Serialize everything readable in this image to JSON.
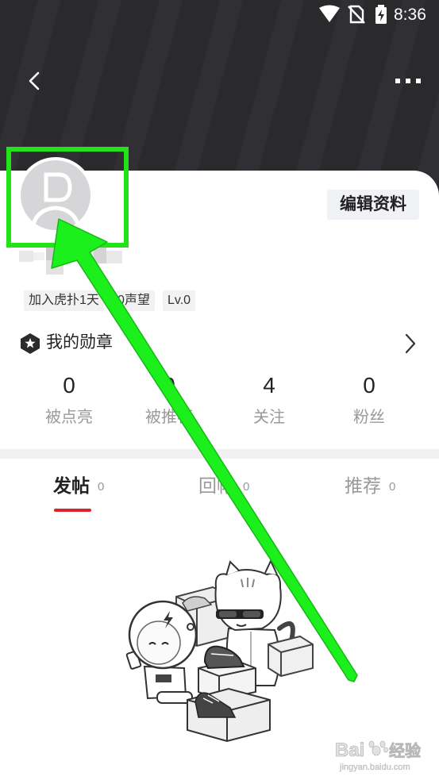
{
  "status_bar": {
    "time": "8:36",
    "icons": [
      "wifi-icon",
      "no-sim-icon",
      "battery-charging-icon"
    ]
  },
  "header": {
    "back_icon": "chevron-left-icon",
    "more_icon": "more-dots-icon"
  },
  "profile": {
    "avatar_icon": "default-avatar-icon",
    "edit_button_label": "编辑资料",
    "tags": [
      "加入虎扑1天",
      "0声望",
      "Lv.0"
    ]
  },
  "medals": {
    "label": "我的勋章",
    "icon": "medal-hexagon-star-icon"
  },
  "stats": [
    {
      "value": "0",
      "label": "被点亮"
    },
    {
      "value": "0",
      "label": "被推荐"
    },
    {
      "value": "4",
      "label": "关注"
    },
    {
      "value": "0",
      "label": "粉丝"
    }
  ],
  "tabs": [
    {
      "label": "发帖",
      "count": "0",
      "active": true
    },
    {
      "label": "回帖",
      "count": "0",
      "active": false
    },
    {
      "label": "推荐",
      "count": "0",
      "active": false
    }
  ],
  "watermark": {
    "brand_left": "Bai",
    "brand_right": "经验",
    "url": "jingyan.baidu.com"
  },
  "colors": {
    "header_bg": "#2a2a2d",
    "accent_red": "#e0212e",
    "annotation_green": "#22e31a"
  }
}
